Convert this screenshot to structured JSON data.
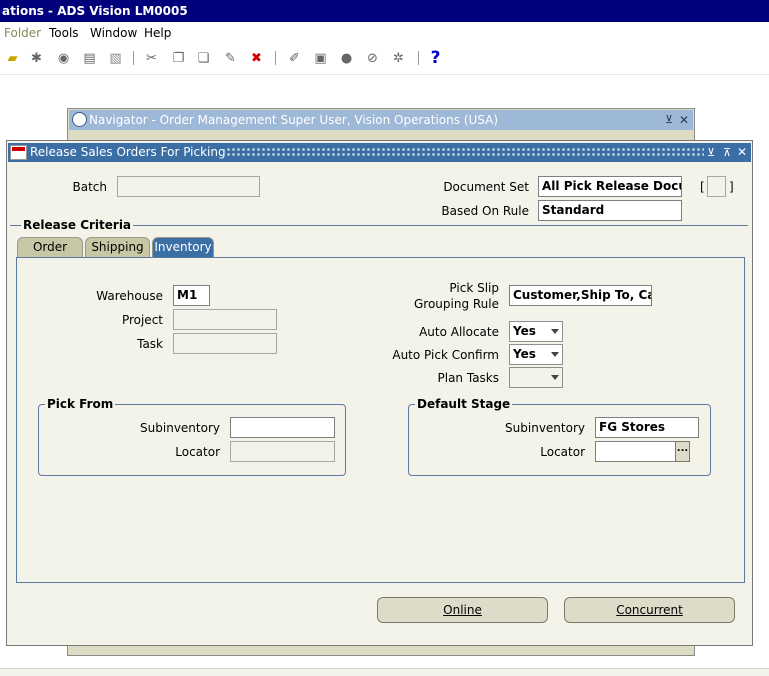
{
  "app": {
    "title": "ations - ADS Vision LM0005",
    "menu": [
      "Folder",
      "Tools",
      "Window",
      "Help"
    ]
  },
  "toolbar": {
    "icons": [
      "open-folder-icon",
      "navigate-icon",
      "zoom-icon",
      "print-icon",
      "save-icon",
      "cut-icon",
      "copy-icon",
      "paste-icon",
      "edit-icon",
      "clear-record-icon",
      "attach-icon",
      "translate-icon",
      "globe-icon",
      "paperclip-icon",
      "folder-tools-icon",
      "help-icon"
    ],
    "help_glyph": "?"
  },
  "navigator": {
    "title": "Navigator - Order Management Super User, Vision Operations (USA)"
  },
  "release": {
    "title": "Release Sales Orders For Picking",
    "batch_label": "Batch",
    "batch_value": "",
    "document_set_label": "Document Set",
    "document_set_value": "All Pick Release Docu",
    "based_on_rule_label": "Based On Rule",
    "based_on_rule_value": "Standard",
    "bracket_left": "[",
    "bracket_right": "]",
    "criteria_title": "Release Criteria",
    "tabs": [
      {
        "label": "Order",
        "active": false
      },
      {
        "label": "Shipping",
        "active": false
      },
      {
        "label": "Inventory",
        "active": true
      }
    ],
    "inventory": {
      "warehouse_label": "Warehouse",
      "warehouse_value": "M1",
      "project_label": "Project",
      "project_value": "",
      "task_label": "Task",
      "task_value": "",
      "pick_slip_label_1": "Pick Slip",
      "pick_slip_label_2": "Grouping Rule",
      "pick_slip_value": "Customer,Ship To, Ca",
      "auto_allocate_label": "Auto Allocate",
      "auto_allocate_value": "Yes",
      "auto_pick_confirm_label": "Auto Pick Confirm",
      "auto_pick_confirm_value": "Yes",
      "plan_tasks_label": "Plan Tasks",
      "plan_tasks_value": "",
      "pick_from": {
        "title": "Pick From",
        "subinventory_label": "Subinventory",
        "subinventory_value": "",
        "locator_label": "Locator",
        "locator_value": ""
      },
      "default_stage": {
        "title": "Default Stage",
        "subinventory_label": "Subinventory",
        "subinventory_value": "FG Stores",
        "locator_label": "Locator",
        "locator_value": "",
        "lov_glyph": "..."
      }
    },
    "buttons": {
      "online": "Online",
      "concurrent": "Concurrent"
    }
  },
  "colors": {
    "title_bar": "#00007b",
    "active_window_title": "#3a6ea5",
    "inactive_window_title": "#9eb8d8",
    "form_background": "#f3f3ea"
  }
}
